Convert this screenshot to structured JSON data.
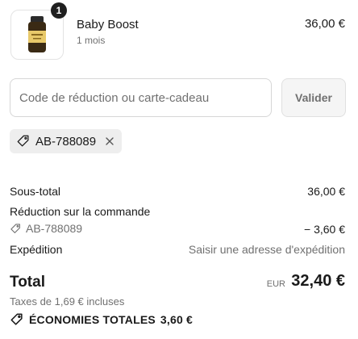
{
  "cart": {
    "item": {
      "quantity": "1",
      "name": "Baby Boost",
      "variant": "1 mois",
      "price": "36,00 €",
      "thumbnail_icon": "supplement-bottle-icon"
    }
  },
  "discount": {
    "placeholder": "Code de réduction ou carte-cadeau",
    "value": "",
    "apply_label": "Valider",
    "applied_code": "AB-788089",
    "tag_icon": "tag-icon",
    "remove_icon": "close-icon"
  },
  "summary": {
    "subtotal_label": "Sous-total",
    "subtotal_value": "36,00 €",
    "order_discount_label": "Réduction sur la commande",
    "order_discount_code": "AB-788089",
    "order_discount_value": "− 3,60 €",
    "shipping_label": "Expédition",
    "shipping_value": "Saisir une adresse d'expédition",
    "total_label": "Total",
    "total_currency": "EUR",
    "total_value": "32,40 €",
    "tax_note": "Taxes de 1,69 € incluses",
    "savings_label": "ÉCONOMIES TOTALES",
    "savings_value": "3,60 €"
  },
  "colors": {
    "text": "#1a1a1a",
    "muted": "#707070",
    "border": "#d6d6d6",
    "chip_bg": "#eeeeee",
    "badge_bg": "#1f1f1f"
  }
}
